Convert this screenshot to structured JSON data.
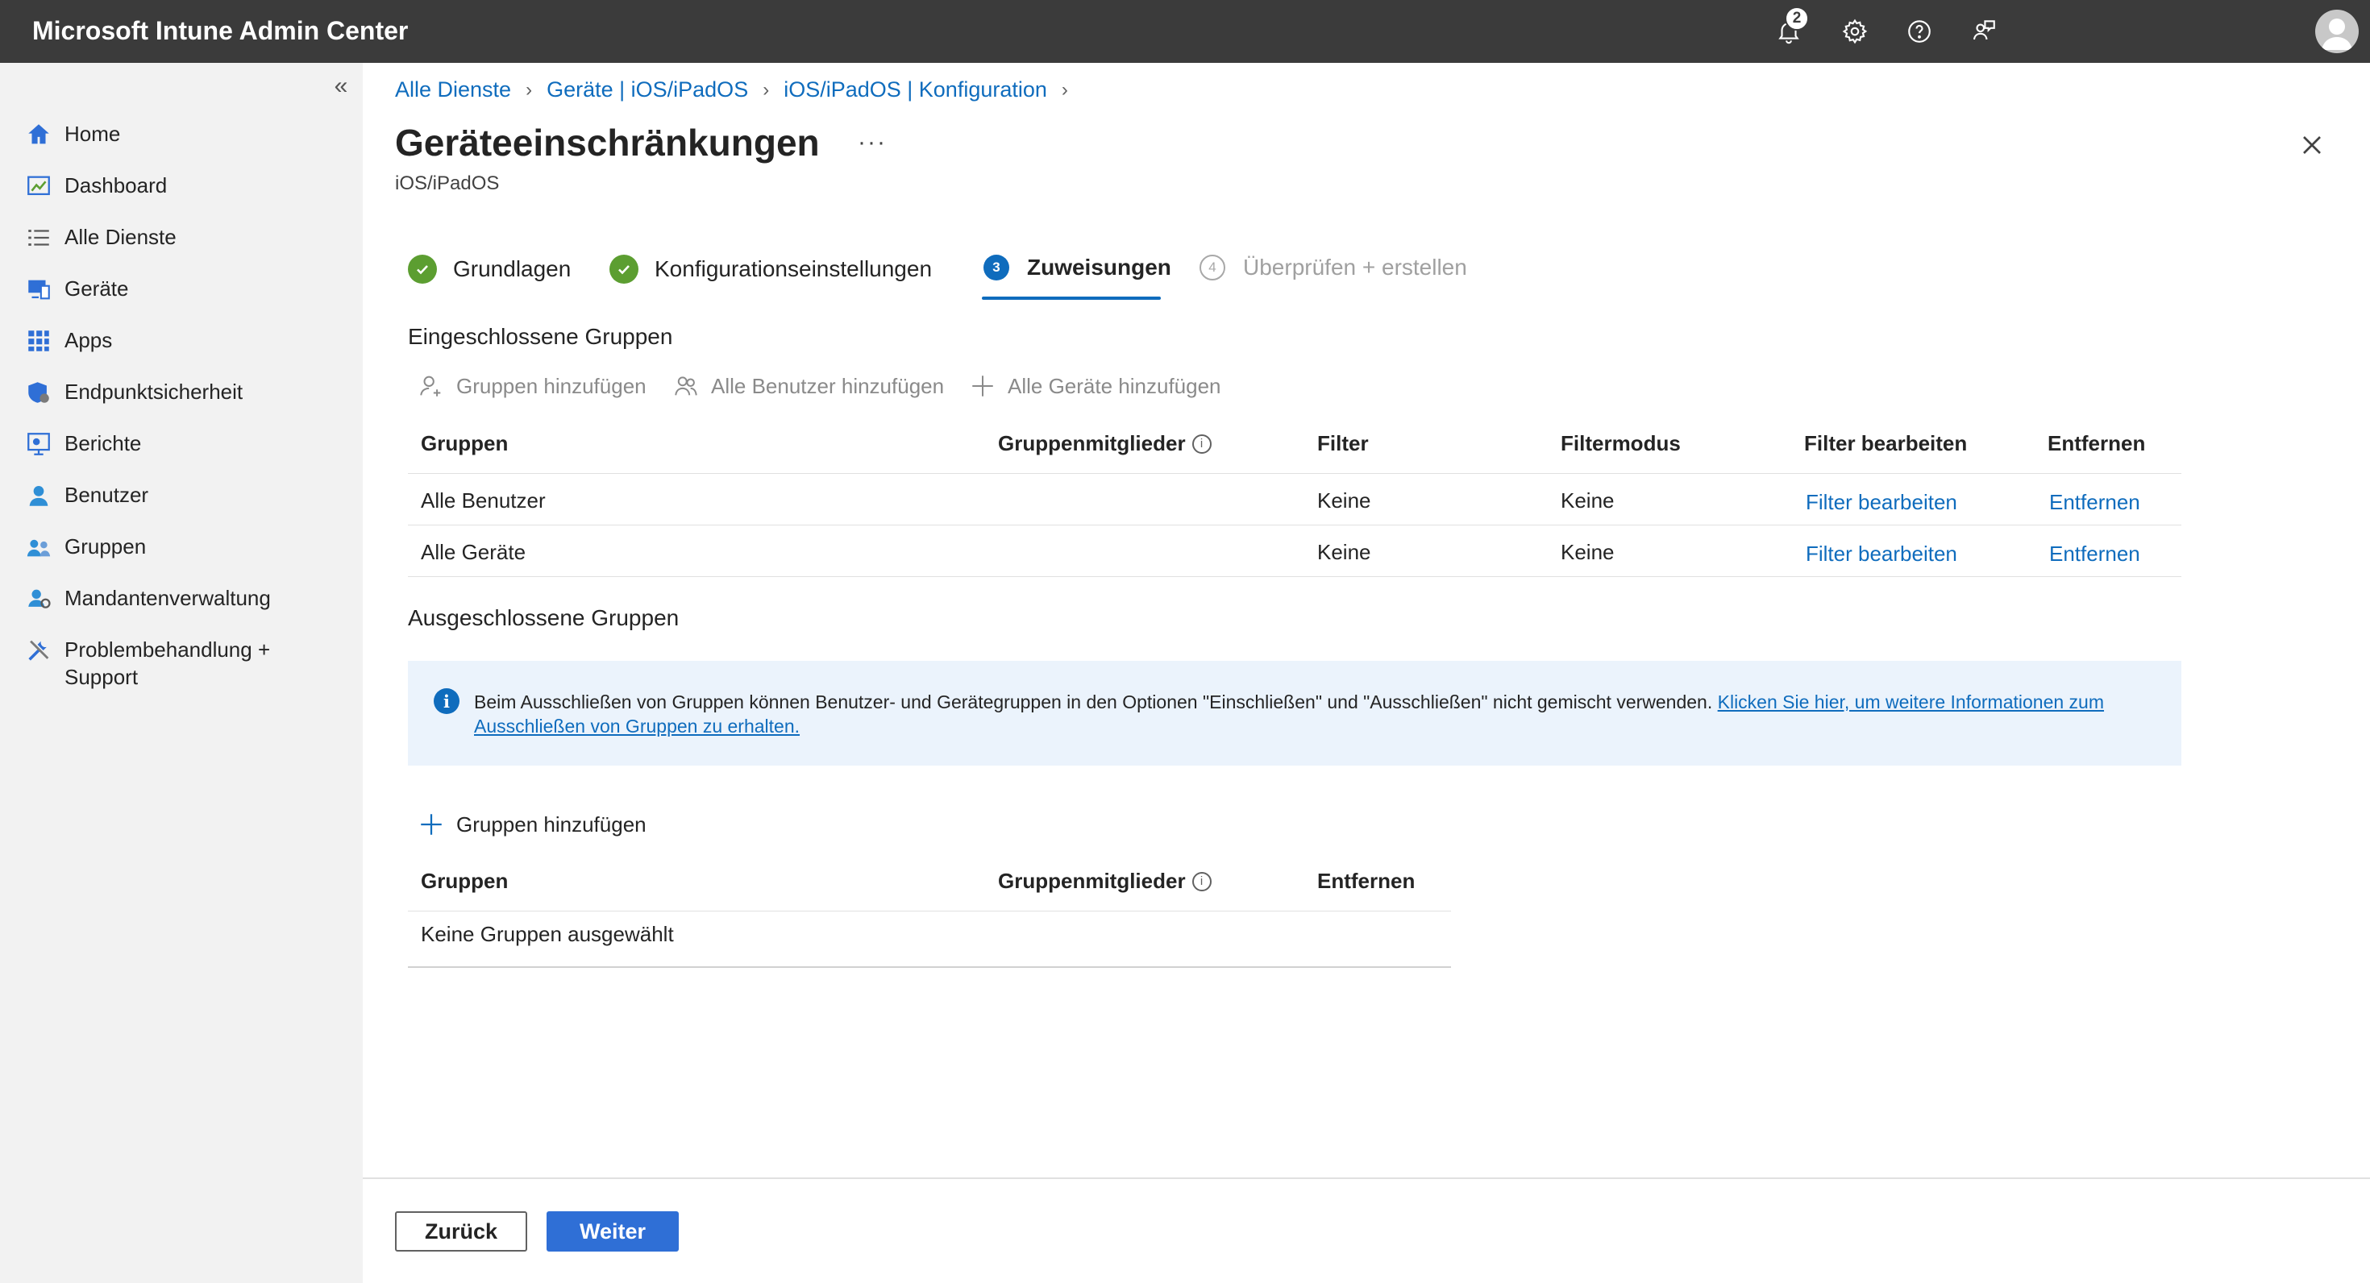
{
  "app": {
    "title": "Microsoft Intune Admin Center"
  },
  "header": {
    "notifications_count": "2",
    "icons": [
      "bell-icon",
      "gear-icon",
      "help-icon",
      "feedback-icon",
      "avatar"
    ]
  },
  "sidebar": {
    "collapse_glyph": "«",
    "items": [
      {
        "label": "Home",
        "icon": "home-icon"
      },
      {
        "label": "Dashboard",
        "icon": "dashboard-icon"
      },
      {
        "label": "Alle Dienste",
        "icon": "list-icon"
      },
      {
        "label": "Geräte",
        "icon": "devices-icon"
      },
      {
        "label": "Apps",
        "icon": "apps-icon"
      },
      {
        "label": "Endpunktsicherheit",
        "icon": "shield-icon"
      },
      {
        "label": "Berichte",
        "icon": "reports-icon"
      },
      {
        "label": "Benutzer",
        "icon": "user-icon"
      },
      {
        "label": "Gruppen",
        "icon": "groups-icon"
      },
      {
        "label": "Mandantenverwaltung",
        "icon": "tenant-icon"
      },
      {
        "label": "Problembehandlung + Support",
        "icon": "tools-icon"
      }
    ]
  },
  "breadcrumb": [
    "Alle Dienste",
    "Geräte | iOS/iPadOS",
    "iOS/iPadOS | Konfiguration"
  ],
  "page": {
    "title": "Geräteeinschränkungen",
    "more": "···",
    "subtitle": "iOS/iPadOS"
  },
  "steps": [
    {
      "label": "Grundlagen",
      "state": "done"
    },
    {
      "label": "Konfigurationseinstellungen",
      "state": "done"
    },
    {
      "label": "Zuweisungen",
      "state": "active",
      "number": "3"
    },
    {
      "label": "Überprüfen + erstellen",
      "state": "pending",
      "number": "4"
    }
  ],
  "included": {
    "title": "Eingeschlossene Gruppen",
    "actions": [
      "Gruppen hinzufügen",
      "Alle Benutzer hinzufügen",
      "Alle Geräte hinzufügen"
    ],
    "columns": [
      "Gruppen",
      "Gruppenmitglieder",
      "Filter",
      "Filtermodus",
      "Filter bearbeiten",
      "Entfernen"
    ],
    "rows": [
      {
        "group": "Alle Benutzer",
        "members": "",
        "filter": "Keine",
        "mode": "Keine",
        "edit": "Filter bearbeiten",
        "remove": "Entfernen"
      },
      {
        "group": "Alle Geräte",
        "members": "",
        "filter": "Keine",
        "mode": "Keine",
        "edit": "Filter bearbeiten",
        "remove": "Entfernen"
      }
    ]
  },
  "excluded": {
    "title": "Ausgeschlossene Gruppen",
    "info_text": "Beim Ausschließen von Gruppen können Benutzer- und Gerätegruppen in den Optionen \"Einschließen\" und \"Ausschließen\" nicht gemischt verwenden. ",
    "info_link": "Klicken Sie hier, um weitere Informationen zum Ausschließen von Gruppen zu erhalten.",
    "add_label": "Gruppen hinzufügen",
    "columns": [
      "Gruppen",
      "Gruppenmitglieder",
      "Entfernen"
    ],
    "empty": "Keine Gruppen ausgewählt"
  },
  "footer": {
    "back": "Zurück",
    "next": "Weiter"
  },
  "colors": {
    "accent": "#0f6cbd",
    "success": "#5c9e31",
    "topbar": "#3b3b3b",
    "sidebar": "#f2f2f2",
    "infobar": "#ebf3fc"
  }
}
